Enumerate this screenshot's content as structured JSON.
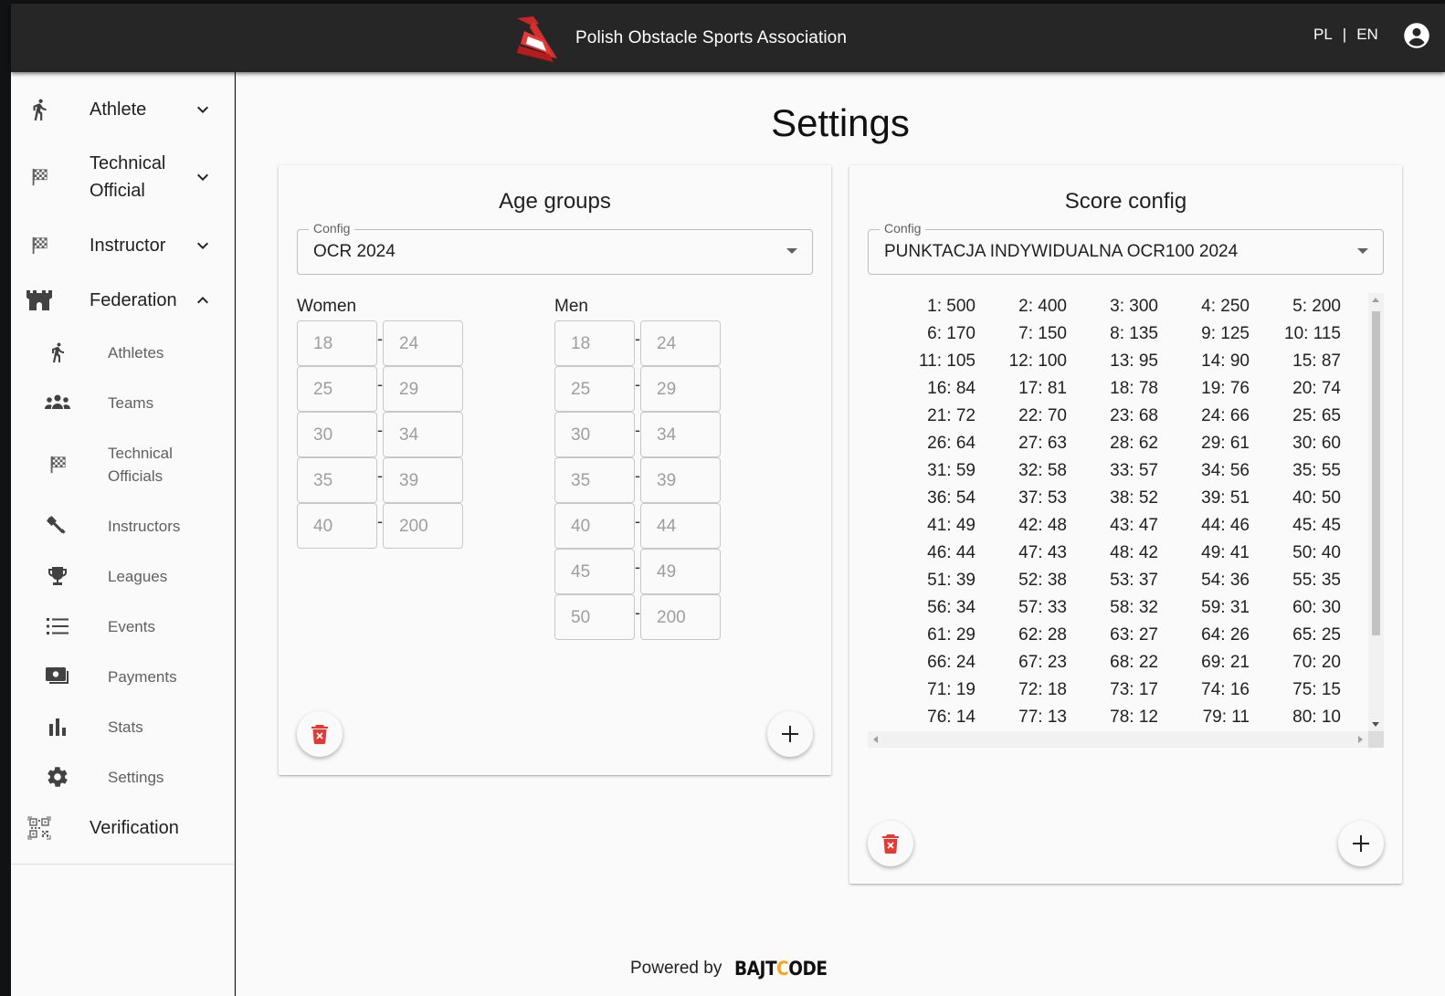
{
  "header": {
    "title": "Polish Obstacle Sports Association",
    "lang_pl": "PL",
    "lang_sep": "|",
    "lang_en": "EN"
  },
  "sidebar": {
    "items": [
      {
        "label": "Athlete",
        "icon": "running-icon"
      },
      {
        "label": "Technical Official",
        "icon": "checkered-flag-icon"
      },
      {
        "label": "Instructor",
        "icon": "checkered-flag-icon"
      },
      {
        "label": "Federation",
        "icon": "castle-icon"
      }
    ],
    "federation_sub": [
      {
        "label": "Athletes",
        "icon": "running-icon"
      },
      {
        "label": "Teams",
        "icon": "group-icon"
      },
      {
        "label": "Technical Officials",
        "icon": "checkered-flag-icon"
      },
      {
        "label": "Instructors",
        "icon": "hammer-icon"
      },
      {
        "label": "Leagues",
        "icon": "trophy-icon"
      },
      {
        "label": "Events",
        "icon": "list-icon"
      },
      {
        "label": "Payments",
        "icon": "payments-icon"
      },
      {
        "label": "Stats",
        "icon": "bar-chart-icon"
      },
      {
        "label": "Settings",
        "icon": "gear-icon"
      }
    ],
    "verification": {
      "label": "Verification",
      "icon": "qr-code-icon"
    }
  },
  "main": {
    "title": "Settings",
    "age_groups": {
      "title": "Age groups",
      "config_label": "Config",
      "config_value": "OCR 2024",
      "women_label": "Women",
      "men_label": "Men",
      "women": [
        [
          "18",
          "24"
        ],
        [
          "25",
          "29"
        ],
        [
          "30",
          "34"
        ],
        [
          "35",
          "39"
        ],
        [
          "40",
          "200"
        ]
      ],
      "men": [
        [
          "18",
          "24"
        ],
        [
          "25",
          "29"
        ],
        [
          "30",
          "34"
        ],
        [
          "35",
          "39"
        ],
        [
          "40",
          "44"
        ],
        [
          "45",
          "49"
        ],
        [
          "50",
          "200"
        ]
      ],
      "dash": "-"
    },
    "score_config": {
      "title": "Score config",
      "config_label": "Config",
      "config_value": "PUNKTACJA INDYWIDUALNA OCR100 2024",
      "scores": [
        "1: 500",
        "2: 400",
        "3: 300",
        "4: 250",
        "5: 200",
        "6: 170",
        "7: 150",
        "8: 135",
        "9: 125",
        "10: 115",
        "11: 105",
        "12: 100",
        "13: 95",
        "14: 90",
        "15: 87",
        "16: 84",
        "17: 81",
        "18: 78",
        "19: 76",
        "20: 74",
        "21: 72",
        "22: 70",
        "23: 68",
        "24: 66",
        "25: 65",
        "26: 64",
        "27: 63",
        "28: 62",
        "29: 61",
        "30: 60",
        "31: 59",
        "32: 58",
        "33: 57",
        "34: 56",
        "35: 55",
        "36: 54",
        "37: 53",
        "38: 52",
        "39: 51",
        "40: 50",
        "41: 49",
        "42: 48",
        "43: 47",
        "44: 46",
        "45: 45",
        "46: 44",
        "47: 43",
        "48: 42",
        "49: 41",
        "50: 40",
        "51: 39",
        "52: 38",
        "53: 37",
        "54: 36",
        "55: 35",
        "56: 34",
        "57: 33",
        "58: 32",
        "59: 31",
        "60: 30",
        "61: 29",
        "62: 28",
        "63: 27",
        "64: 26",
        "65: 25",
        "66: 24",
        "67: 23",
        "68: 22",
        "69: 21",
        "70: 20",
        "71: 19",
        "72: 18",
        "73: 17",
        "74: 16",
        "75: 15",
        "76: 14",
        "77: 13",
        "78: 12",
        "79: 11",
        "80: 10"
      ]
    }
  },
  "footer": {
    "text": "Powered by",
    "logo_a": "BAJT",
    "logo_b": "C",
    "logo_c": "ODE"
  },
  "colors": {
    "topbar": "#262626",
    "brand_red": "#d32f2f",
    "delete_red": "#e53935",
    "logo_accent": "#f5a623"
  }
}
